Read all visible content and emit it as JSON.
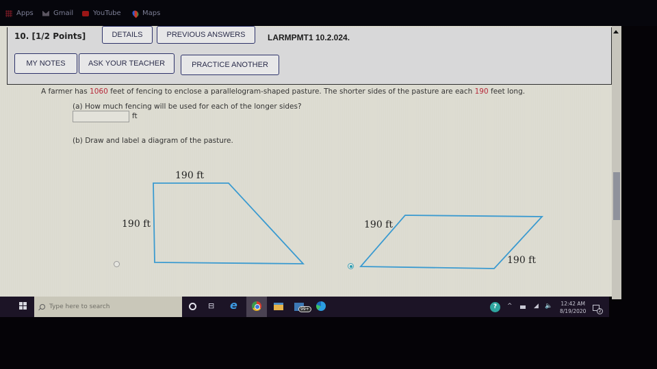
{
  "bookmarks": [
    {
      "label": "Apps",
      "icon": "apps-grid-icon"
    },
    {
      "label": "Gmail",
      "icon": "gmail-icon"
    },
    {
      "label": "YouTube",
      "icon": "youtube-icon"
    },
    {
      "label": "Maps",
      "icon": "maps-pin-icon"
    }
  ],
  "question": {
    "number": "10.",
    "points": "[1/2 Points]",
    "buttons": {
      "details": "DETAILS",
      "previous_answers": "PREVIOUS ANSWERS",
      "my_notes": "MY NOTES",
      "ask_teacher": "ASK YOUR TEACHER",
      "practice_another": "PRACTICE ANOTHER"
    },
    "code": "LARMPMT1 10.2.024.",
    "prompt": {
      "part1": "A farmer has ",
      "fencing_total": "1060",
      "part2": " feet of fencing to enclose a parallelogram-shaped pasture. The shorter sides of the pasture are each ",
      "short_side": "190",
      "part3": " feet long."
    },
    "part_a": {
      "label": "(a) How much fencing will be used for each of the longer sides?",
      "value": "",
      "unit": "ft"
    },
    "part_b": {
      "label": "(b) Draw and label a diagram of the pasture.",
      "options": [
        {
          "shape": "trapezoid",
          "labels": [
            "190 ft",
            "190 ft"
          ],
          "selected": false
        },
        {
          "shape": "parallelogram",
          "labels": [
            "190 ft",
            "190 ft"
          ],
          "selected": true
        }
      ]
    }
  },
  "taskbar": {
    "search_placeholder": "Type here to search",
    "apps": [
      "cortana",
      "task-view",
      "internet-explorer",
      "chrome",
      "file-explorer",
      "mail",
      "edge"
    ],
    "mail_badge": "99+",
    "time": "12:42 AM",
    "date": "8/19/2020",
    "notification_count": "2"
  },
  "colors": {
    "accent_blue": "#3a9ad0",
    "highlight_red": "#b7283a",
    "button_border": "#2b3068"
  }
}
